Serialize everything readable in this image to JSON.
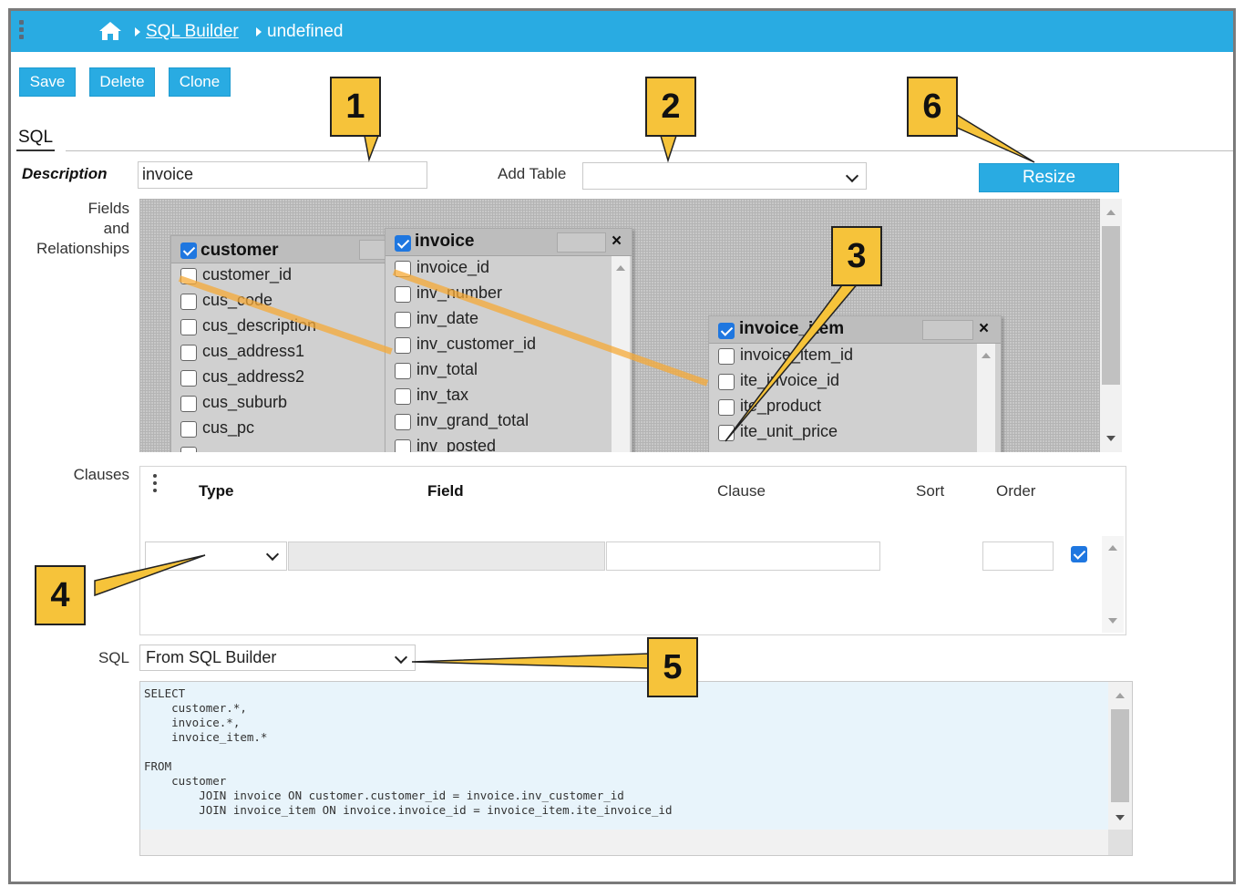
{
  "breadcrumb": {
    "link": "SQL Builder",
    "current": "undefined"
  },
  "toolbar": {
    "save": "Save",
    "delete": "Delete",
    "clone": "Clone"
  },
  "tab": {
    "label": "SQL"
  },
  "form": {
    "description_label": "Description",
    "description_value": "invoice",
    "add_table_label": "Add Table",
    "add_table_value": "",
    "resize_label": "Resize",
    "fields_label_1": "Fields",
    "fields_label_2": "and",
    "fields_label_3": "Relationships",
    "clauses_label": "Clauses",
    "sql_label": "SQL",
    "sql_source": "From SQL Builder"
  },
  "tables": {
    "customer": {
      "title": "customer",
      "fields": [
        "customer_id",
        "cus_code",
        "cus_description",
        "cus_address1",
        "cus_address2",
        "cus_suburb",
        "cus_pc"
      ]
    },
    "invoice": {
      "title": "invoice",
      "fields": [
        "invoice_id",
        "inv_number",
        "inv_date",
        "inv_customer_id",
        "inv_total",
        "inv_tax",
        "inv_grand_total",
        "inv_posted"
      ]
    },
    "invoice_item": {
      "title": "invoice_item",
      "fields": [
        "invoice_item_id",
        "ite_invoice_id",
        "ite_product",
        "ite_unit_price"
      ]
    }
  },
  "clauses": {
    "headers": {
      "type": "Type",
      "field": "Field",
      "clause": "Clause",
      "sort": "Sort",
      "order": "Order"
    }
  },
  "sql_text": "SELECT\n    customer.*,\n    invoice.*,\n    invoice_item.*\n\nFROM\n    customer\n        JOIN invoice ON customer.customer_id = invoice.inv_customer_id\n        JOIN invoice_item ON invoice.invoice_id = invoice_item.ite_invoice_id",
  "callouts": [
    "1",
    "2",
    "3",
    "4",
    "5",
    "6"
  ],
  "colors": {
    "accent": "#29abe2",
    "callout": "#f6c33a",
    "relationship": "#f5aa37",
    "sql_bg": "#e8f4fb"
  },
  "icons": [
    "home-icon",
    "drag-handle-icon",
    "chevron-down-icon",
    "close-icon",
    "checkbox-icon"
  ]
}
